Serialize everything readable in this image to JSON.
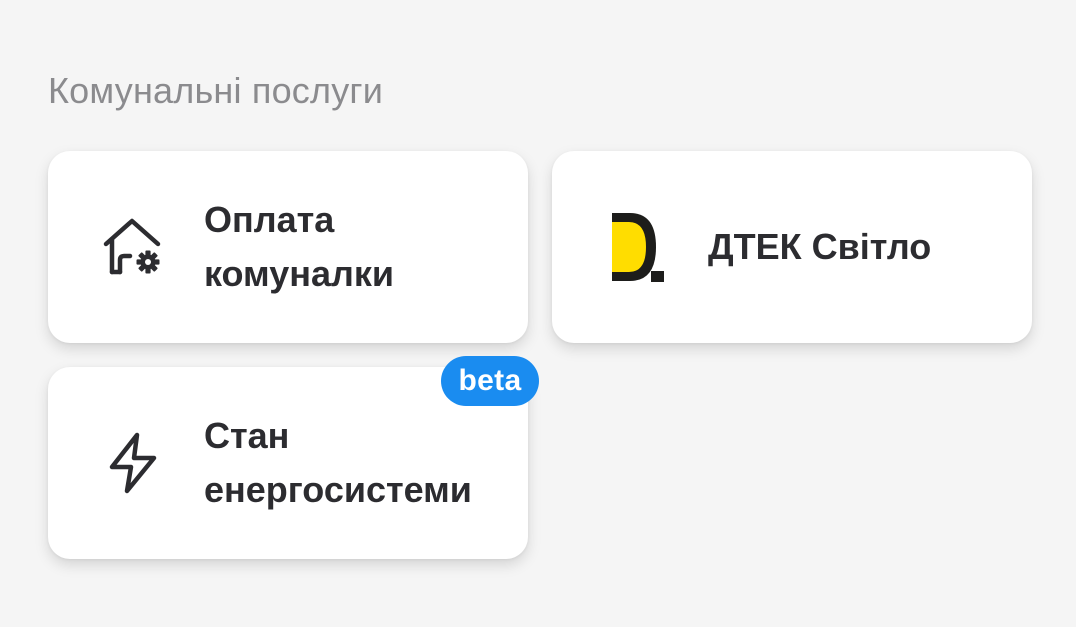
{
  "section": {
    "title": "Комунальні послуги"
  },
  "cards": [
    {
      "label_line1": "Оплата",
      "label_line2": "комуналки",
      "icon": "house-gear-icon"
    },
    {
      "label": "ДТЕК Світло",
      "icon": "dtek-logo-icon"
    },
    {
      "label_line1": "Стан",
      "label_line2": "енергосистеми",
      "icon": "lightning-icon",
      "badge": "beta"
    }
  ],
  "colors": {
    "background": "#f5f5f5",
    "card": "#ffffff",
    "title": "#8b8b8e",
    "text": "#2c2c30",
    "badge": "#1a8cf0",
    "dtek_yellow": "#ffdd00",
    "dtek_dark": "#1d1d1b"
  }
}
